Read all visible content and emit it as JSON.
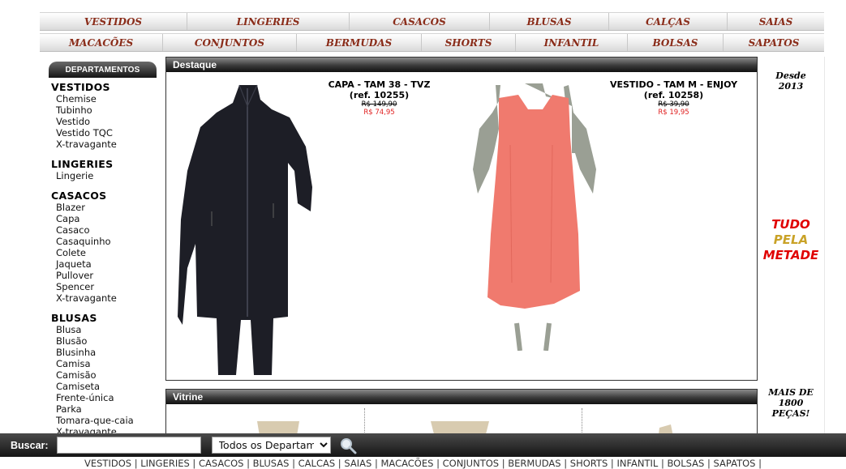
{
  "nav": {
    "row1": [
      "VESTIDOS",
      "LINGERIES",
      "CASACOS",
      "BLUSAS",
      "CALÇAS",
      "SAIAS"
    ],
    "row2": [
      "MACACÕES",
      "CONJUNTOS",
      "BERMUDAS",
      "SHORTS",
      "INFANTIL",
      "BOLSAS",
      "SAPATOS"
    ]
  },
  "sidebar": {
    "header": "DEPARTAMENTOS",
    "groups": [
      {
        "title": "VESTIDOS",
        "items": [
          "Chemise",
          "Tubinho",
          "Vestido",
          "Vestido TQC",
          "X-travagante"
        ]
      },
      {
        "title": "LINGERIES",
        "items": [
          "Lingerie"
        ]
      },
      {
        "title": "CASACOS",
        "items": [
          "Blazer",
          "Capa",
          "Casaco",
          "Casaquinho",
          "Colete",
          "Jaqueta",
          "Pullover",
          "Spencer",
          "X-travagante"
        ]
      },
      {
        "title": "BLUSAS",
        "items": [
          "Blusa",
          "Blusão",
          "Blusinha",
          "Camisa",
          "Camisão",
          "Camiseta",
          "Frente-única",
          "Parka",
          "Tomara-que-caia",
          "X-travagante"
        ]
      }
    ]
  },
  "destaque": {
    "title": "Destaque",
    "products": [
      {
        "name": "CAPA - TAM 38 - TVZ",
        "ref": "(ref. 10255)",
        "old_price": "R$ 149,90",
        "new_price": "R$ 74,95"
      },
      {
        "name": "VESTIDO - TAM M - ENJOY",
        "ref": "(ref. 10258)",
        "old_price": "R$ 39,90",
        "new_price": "R$ 19,95"
      }
    ]
  },
  "vitrine": {
    "title": "Vitrine"
  },
  "right": {
    "desde": [
      "Desde",
      "2013"
    ],
    "promo": [
      "TUDO",
      "PELA",
      "METADE"
    ],
    "mais": [
      "MAIS DE",
      "1800",
      "PEÇAS!"
    ]
  },
  "search": {
    "label": "Buscar:",
    "input_value": "",
    "select_value": "Todos os Departamentos",
    "icon": "magnifier-icon"
  },
  "footer": {
    "links": [
      "VESTIDOS",
      "LINGERIES",
      "CASACOS",
      "BLUSAS",
      "CALCAS",
      "SAIAS",
      "MACACÕES",
      "CONJUNTOS",
      "BERMUDAS",
      "SHORTS",
      "INFANTIL",
      "BOLSAS",
      "SAPATOS"
    ]
  },
  "colors": {
    "nav_text": "#8a2c19",
    "price_red": "#e02020",
    "promo_red": "#e00000",
    "promo_gold": "#c9a227"
  }
}
